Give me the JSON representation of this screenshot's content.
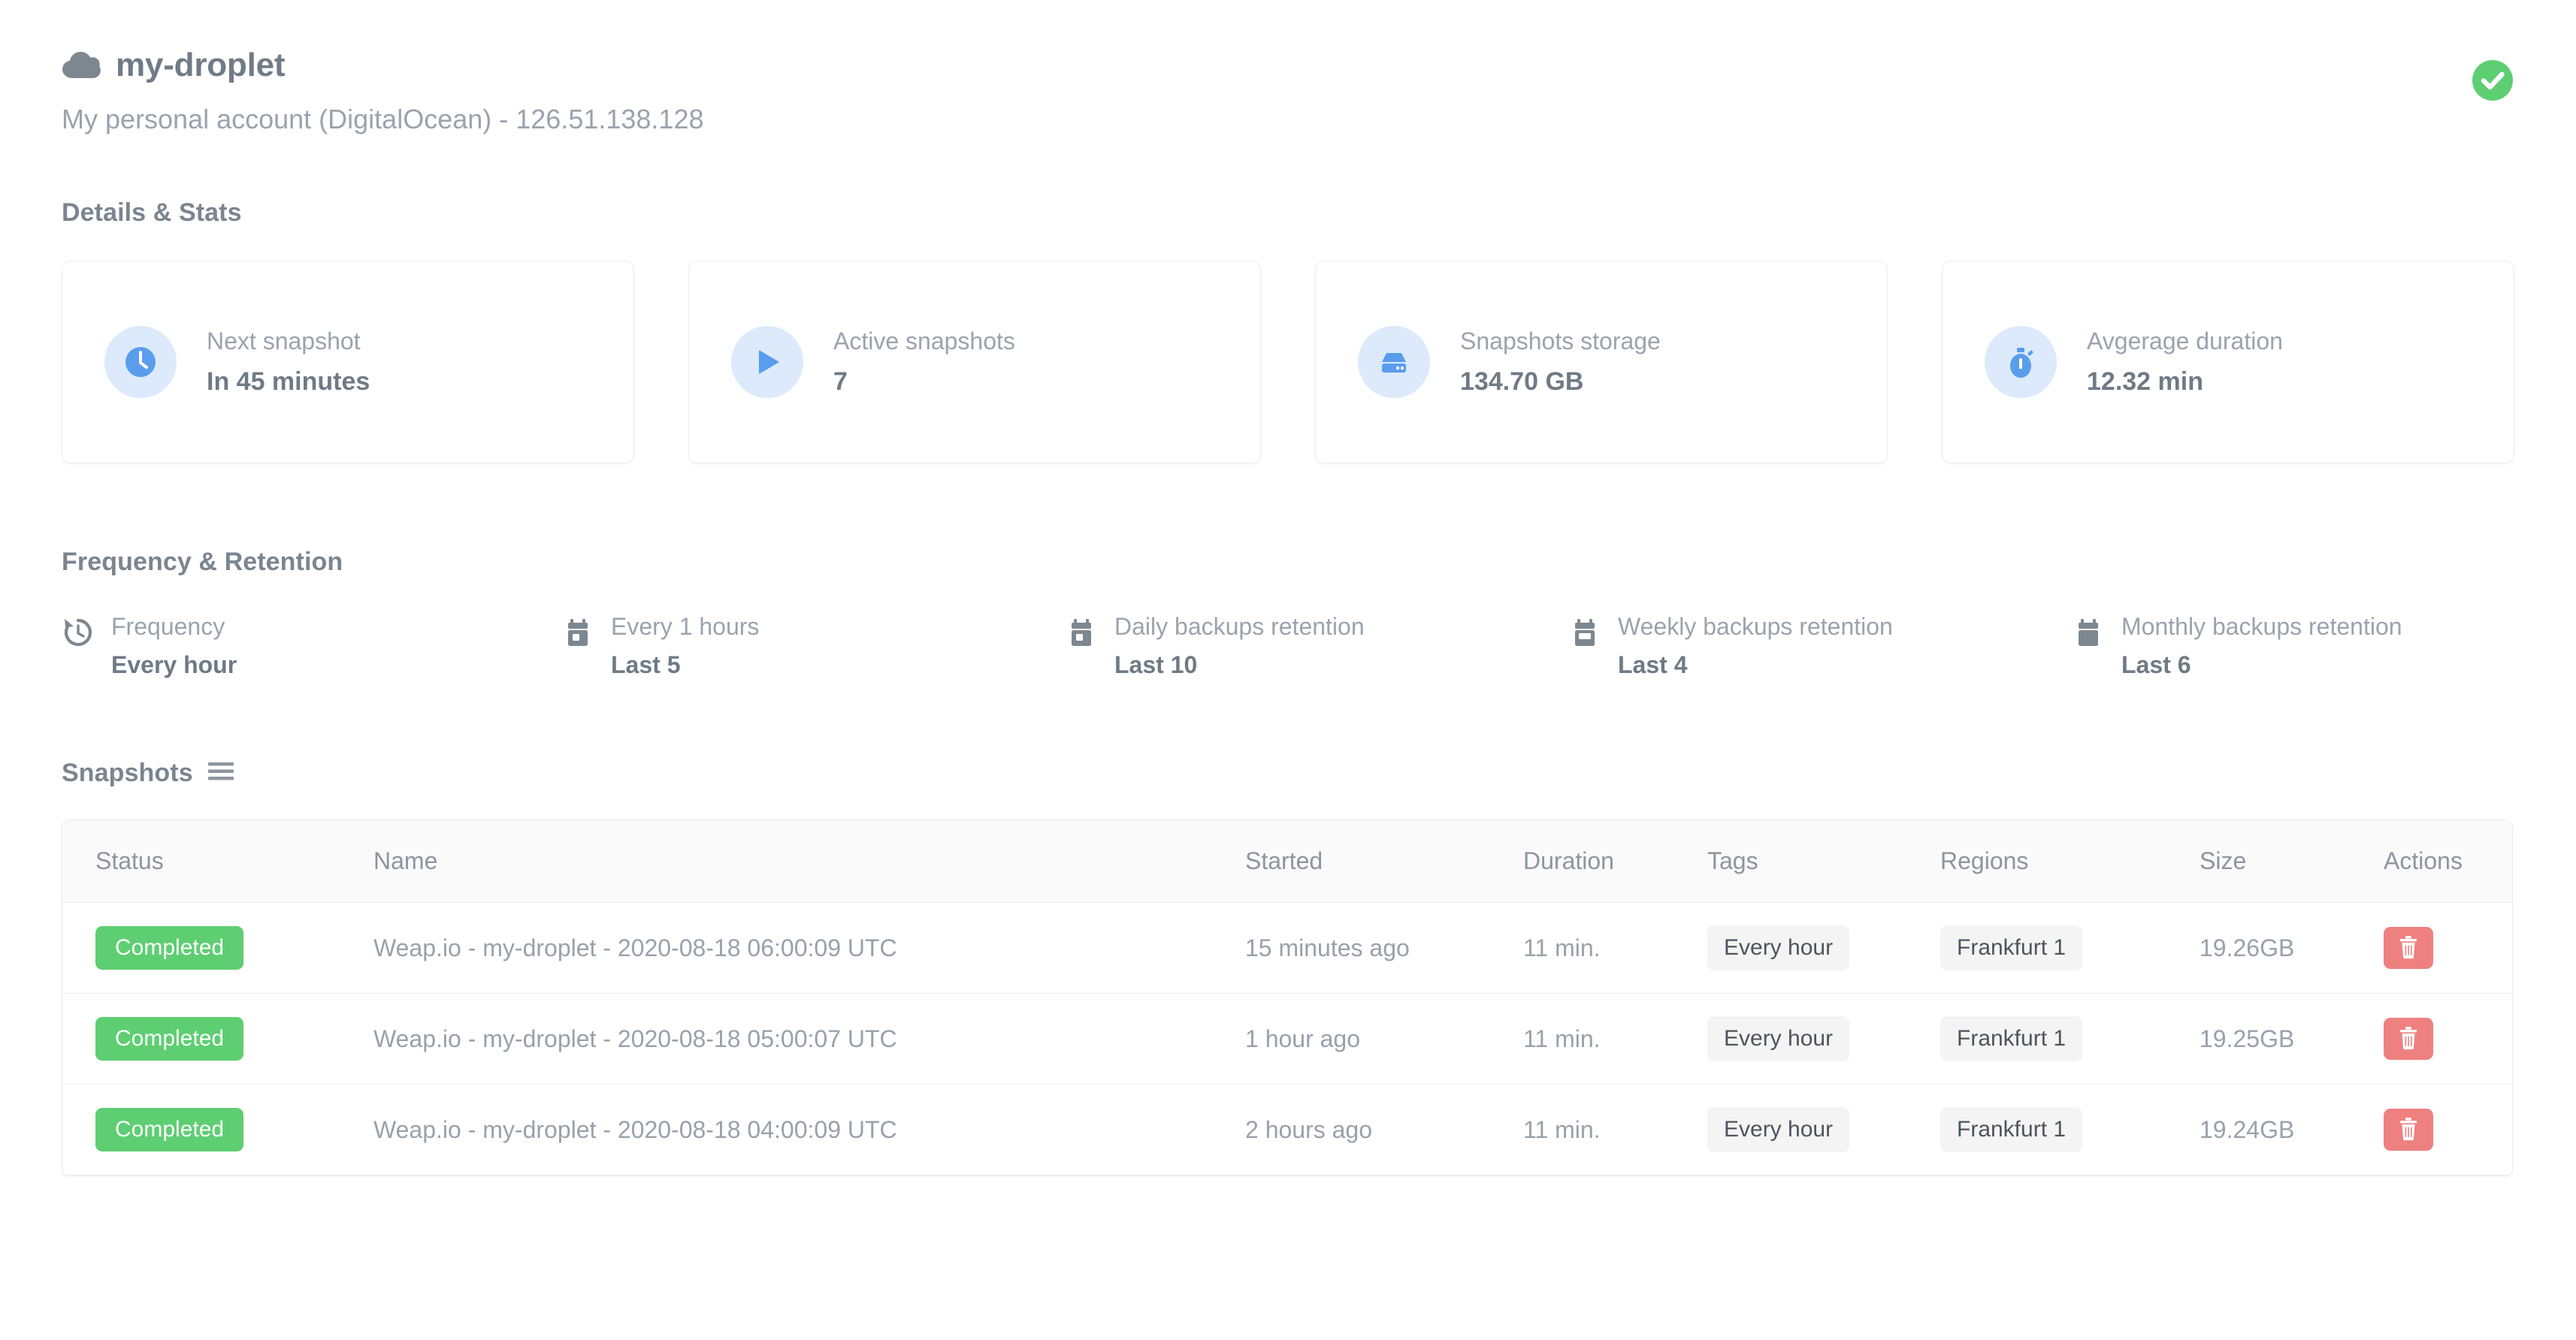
{
  "header": {
    "cloud_icon": "cloud-icon",
    "title": "my-droplet",
    "subtitle": "My personal account (DigitalOcean) - 126.51.138.128",
    "status_icon": "check-circle-icon",
    "status_color": "#5ece72"
  },
  "details_stats": {
    "section_title": "Details & Stats",
    "cards": [
      {
        "icon": "clock-icon",
        "label": "Next snapshot",
        "value": "In 45 minutes"
      },
      {
        "icon": "play-icon",
        "label": "Active snapshots",
        "value": "7"
      },
      {
        "icon": "hard-drive-icon",
        "label": "Snapshots storage",
        "value": "134.70 GB"
      },
      {
        "icon": "stopwatch-icon",
        "label": "Avgerage duration",
        "value": "12.32 min"
      }
    ]
  },
  "frequency_retention": {
    "section_title": "Frequency & Retention",
    "items": [
      {
        "icon": "history-icon",
        "label": "Frequency",
        "value": "Every hour"
      },
      {
        "icon": "calendar-icon",
        "label": "Every 1 hours",
        "value": "Last 5"
      },
      {
        "icon": "calendar-icon",
        "label": "Daily backups retention",
        "value": "Last 10"
      },
      {
        "icon": "calendar-icon",
        "label": "Weekly backups retention",
        "value": "Last 4"
      },
      {
        "icon": "calendar-icon",
        "label": "Monthly backups retention",
        "value": "Last 6"
      }
    ]
  },
  "snapshots": {
    "section_title": "Snapshots",
    "menu_icon": "hamburger-icon",
    "columns": [
      "Status",
      "Name",
      "Started",
      "Duration",
      "Tags",
      "Regions",
      "Size",
      "Actions"
    ],
    "rows": [
      {
        "status": "Completed",
        "name": "Weap.io - my-droplet - 2020-08-18 06:00:09 UTC",
        "started": "15 minutes ago",
        "duration": "11 min.",
        "tag": "Every hour",
        "region": "Frankfurt 1",
        "size": "19.26GB",
        "action_icon": "trash-icon"
      },
      {
        "status": "Completed",
        "name": "Weap.io - my-droplet - 2020-08-18 05:00:07 UTC",
        "started": "1 hour ago",
        "duration": "11 min.",
        "tag": "Every hour",
        "region": "Frankfurt 1",
        "size": "19.25GB",
        "action_icon": "trash-icon"
      },
      {
        "status": "Completed",
        "name": "Weap.io - my-droplet - 2020-08-18 04:00:09 UTC",
        "started": "2 hours ago",
        "duration": "11 min.",
        "tag": "Every hour",
        "region": "Frankfurt 1",
        "size": "19.24GB",
        "action_icon": "trash-icon"
      }
    ]
  },
  "colors": {
    "success_green": "#5ece72",
    "accent_blue": "#5a9ded",
    "icon_bg_blue": "#dceafb",
    "danger_red": "#ef8080",
    "text_muted": "#9aa3ad",
    "text_strong": "#6f7a85"
  }
}
